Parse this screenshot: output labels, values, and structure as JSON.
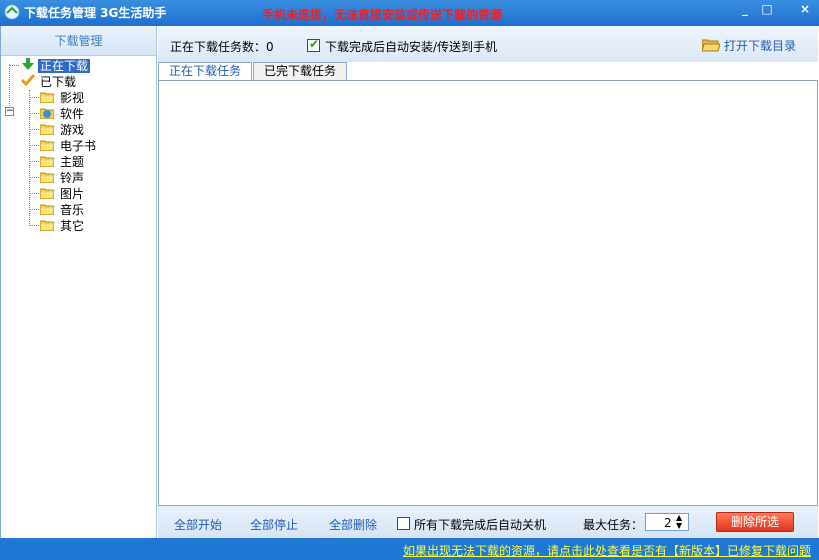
{
  "window": {
    "title": "下载任务管理 3G生活助手",
    "warning": "手机未连接，无法直接安装或传送下载的资源"
  },
  "sidebar": {
    "header": "下载管理",
    "downloading": "正在下载",
    "downloaded": "已下载",
    "categories": [
      "影视",
      "软件",
      "游戏",
      "电子书",
      "主题",
      "铃声",
      "图片",
      "音乐",
      "其它"
    ]
  },
  "topbar": {
    "count_label": "正在下载任务数：0",
    "auto_install_label": "下载完成后自动安装/传送到手机",
    "open_dir_label": "打开下载目录"
  },
  "tabs": {
    "downloading": "正在下载任务",
    "completed": "已完下载任务"
  },
  "bottombar": {
    "start_all": "全部开始",
    "stop_all": "全部停止",
    "delete_all": "全部删除",
    "shutdown_label": "所有下载完成后自动关机",
    "max_tasks_label": "最大任务：",
    "max_tasks_value": "2",
    "delete_selected": "删除所选"
  },
  "statusbar": {
    "link": "如果出现无法下载的资源，请点击此处查看是否有【新版本】已修复下载问题"
  },
  "colors": {
    "titlebar": "#1f6fcf",
    "warning": "#ff1a1a",
    "link": "#1f5cb4",
    "status_link": "#ffff33",
    "delete_button": "#e0341b"
  }
}
